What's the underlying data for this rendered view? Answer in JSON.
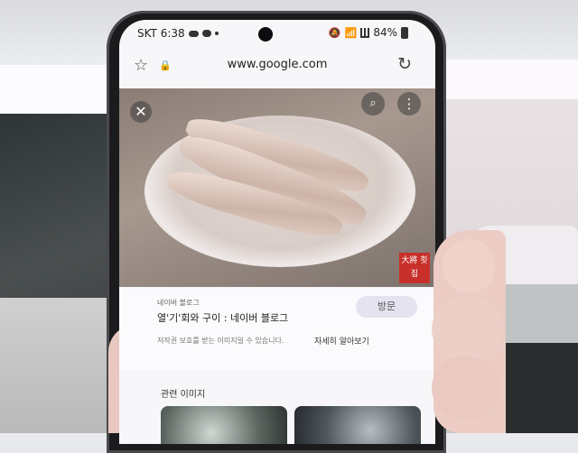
{
  "status_bar": {
    "carrier_time": "SKT 6:38",
    "battery": "84%",
    "icons": [
      "cloud-icon",
      "chat-icon",
      "dot",
      "mute-icon",
      "wifi-icon",
      "signal-icon",
      "battery-icon"
    ]
  },
  "browser": {
    "url": "www.google.com",
    "icons": [
      "star-icon",
      "lock-icon",
      "reload-icon"
    ]
  },
  "image_viewer": {
    "icons": [
      "close-icon",
      "lens-icon",
      "more-icon"
    ],
    "watermark": "大將 횟집"
  },
  "result": {
    "source": "네이버 블로그",
    "title": "열'기'회와 구이 : 네이버 블로그",
    "visit_label": "방문",
    "copyright_note": "저작권 보호를 받는 이미지일 수 있습니다.",
    "learn_more": "자세히 알아보기"
  },
  "related": {
    "title": "관련 이미지"
  }
}
